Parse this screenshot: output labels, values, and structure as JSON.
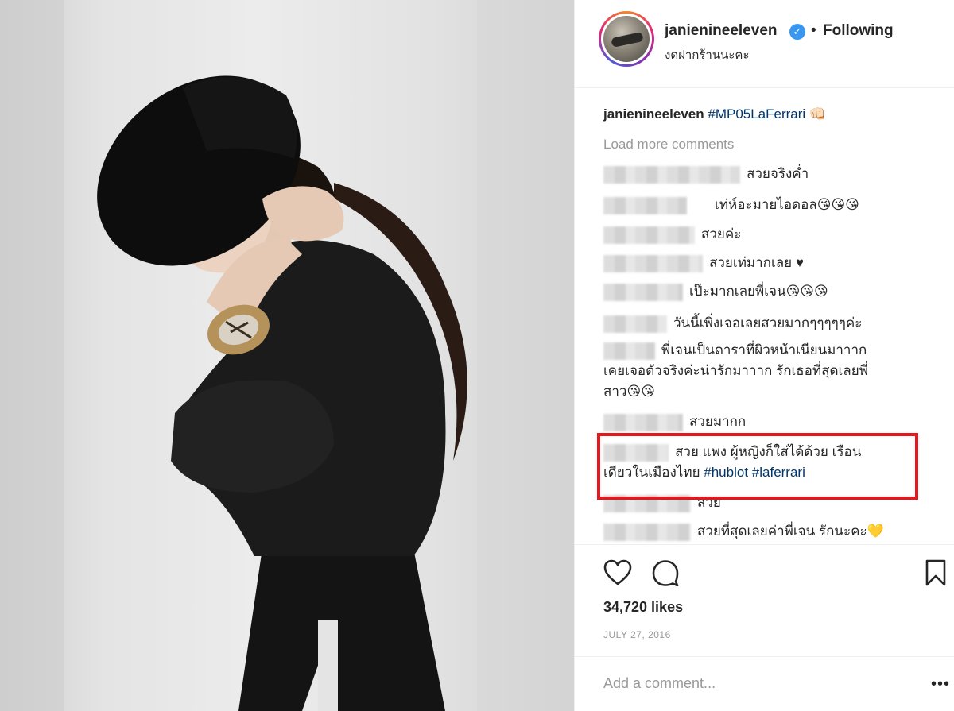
{
  "post": {
    "username": "janienineeleven",
    "follow_separator": "•",
    "follow_status": "Following",
    "location": "งดฝากร้านนะคะ",
    "verified_icon": "verified-badge-icon"
  },
  "caption": {
    "username": "janienineeleven",
    "hashtag": "#MP05LaFerrari",
    "emoji": "👊🏻"
  },
  "load_more": "Load more comments",
  "comments": [
    {
      "text": "สวยจริงค่ำ",
      "emoji": ""
    },
    {
      "text": "เท่ห์อะมายไอดอล",
      "emoji": "😘😘😘"
    },
    {
      "text": "สวยค่ะ",
      "emoji": ""
    },
    {
      "text": "สวยเท่มากเลย ♥",
      "emoji": ""
    },
    {
      "text": "เป๊ะมากเลยพี่เจน",
      "emoji": "😘😘😘"
    },
    {
      "text": "วันนี้เพิ่งเจอเลยสวยมากๆๆๆๆๆค่ะ",
      "emoji": ""
    },
    {
      "text_line1": "พี่เจนเป็นดาราที่ผิวหน้าเนียนมาาาก",
      "text_line2": "เคยเจอตัวจริงค่ะน่ารักมาาาก รักเธอที่สุดเลยพี่",
      "text_line3": "สาว",
      "emoji": "😘😘"
    },
    {
      "text": "สวยมากก",
      "emoji": ""
    },
    {
      "text_line1": "สวย แพง ผู้หญิงก็ใส่ได้ด้วย เรือน",
      "text_line2": "เดียวในเมืองไทย",
      "hashtag1": "#hublot",
      "hashtag2": "#laferrari"
    },
    {
      "text": "สวย",
      "emoji": ""
    },
    {
      "text": "สวยที่สุดเลยค่าพี่เจน รักนะคะ",
      "emoji": "💛"
    }
  ],
  "likes": "34,720 likes",
  "date": "JULY 27, 2016",
  "add_comment_placeholder": "Add a comment...",
  "more_options": "•••",
  "colors": {
    "highlight_border": "#e8151b",
    "hashtag": "#003569",
    "muted": "#999999",
    "text": "#262626"
  }
}
